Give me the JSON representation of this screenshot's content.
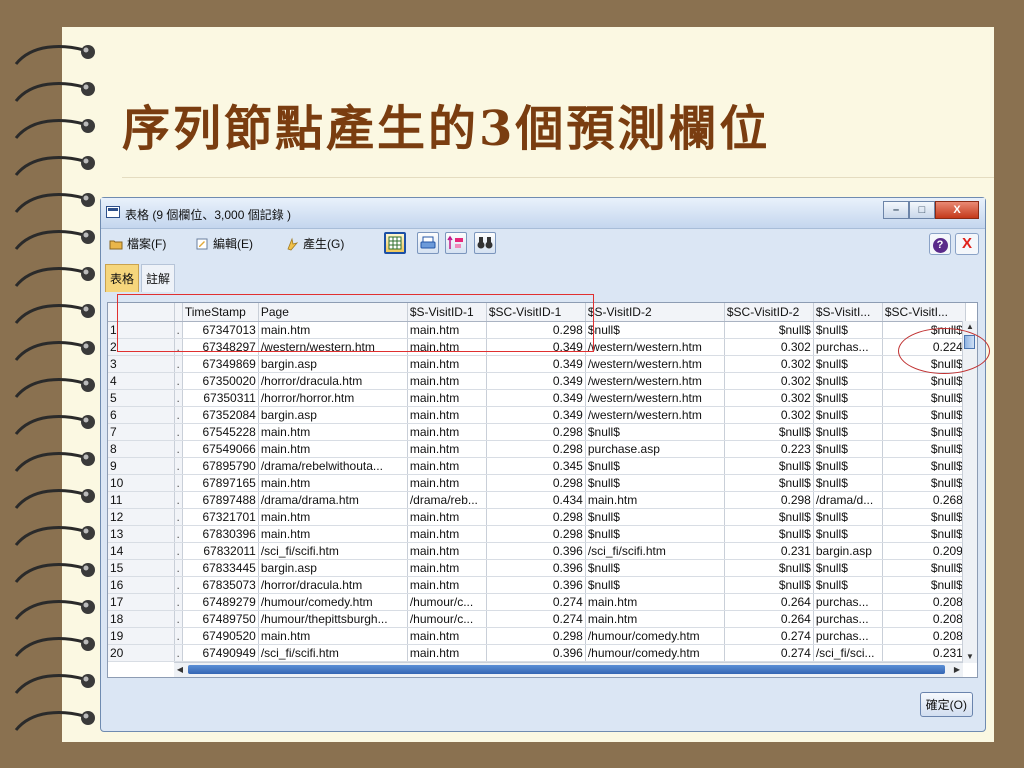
{
  "slide": {
    "title": "序列節點產生的3個預測欄位"
  },
  "window": {
    "title": "表格 (9 個欄位、3,000 個記錄 )",
    "caption_buttons": [
      "–",
      "□",
      "X"
    ]
  },
  "menu": {
    "items": [
      {
        "label": "檔案(F)",
        "icon": "folder-icon"
      },
      {
        "label": "編輯(E)",
        "icon": "edit-icon"
      },
      {
        "label": "產生(G)",
        "icon": "generate-icon"
      }
    ],
    "help": "?",
    "close": "X"
  },
  "tabs": [
    {
      "label": "表格",
      "active": true
    },
    {
      "label": "註解",
      "active": false
    }
  ],
  "table": {
    "columns": [
      "",
      "",
      "TimeStamp",
      "Page",
      "$S-VisitID-1",
      "$SC-VisitID-1",
      "$S-VisitID-2",
      "$SC-VisitID-2",
      "$S-VisitI...",
      "$SC-VisitI..."
    ],
    "rows": [
      [
        "1",
        ".",
        "67347013",
        "main.htm",
        "main.htm",
        "0.298",
        "$null$",
        "$null$",
        "$null$",
        "$null$"
      ],
      [
        "2",
        ".",
        "67348297",
        "/western/western.htm",
        "main.htm",
        "0.349",
        "/western/western.htm",
        "0.302",
        "purchas...",
        "0.224"
      ],
      [
        "3",
        ".",
        "67349869",
        "bargin.asp",
        "main.htm",
        "0.349",
        "/western/western.htm",
        "0.302",
        "$null$",
        "$null$"
      ],
      [
        "4",
        ".",
        "67350020",
        "/horror/dracula.htm",
        "main.htm",
        "0.349",
        "/western/western.htm",
        "0.302",
        "$null$",
        "$null$"
      ],
      [
        "5",
        ".",
        "67350311",
        "/horror/horror.htm",
        "main.htm",
        "0.349",
        "/western/western.htm",
        "0.302",
        "$null$",
        "$null$"
      ],
      [
        "6",
        ".",
        "67352084",
        "bargin.asp",
        "main.htm",
        "0.349",
        "/western/western.htm",
        "0.302",
        "$null$",
        "$null$"
      ],
      [
        "7",
        ".",
        "67545228",
        "main.htm",
        "main.htm",
        "0.298",
        "$null$",
        "$null$",
        "$null$",
        "$null$"
      ],
      [
        "8",
        ".",
        "67549066",
        "main.htm",
        "main.htm",
        "0.298",
        "purchase.asp",
        "0.223",
        "$null$",
        "$null$"
      ],
      [
        "9",
        ".",
        "67895790",
        "/drama/rebelwithouta...",
        "main.htm",
        "0.345",
        "$null$",
        "$null$",
        "$null$",
        "$null$"
      ],
      [
        "10",
        ".",
        "67897165",
        "main.htm",
        "main.htm",
        "0.298",
        "$null$",
        "$null$",
        "$null$",
        "$null$"
      ],
      [
        "11",
        ".",
        "67897488",
        "/drama/drama.htm",
        "/drama/reb...",
        "0.434",
        "main.htm",
        "0.298",
        "/drama/d...",
        "0.268"
      ],
      [
        "12",
        ".",
        "67321701",
        "main.htm",
        "main.htm",
        "0.298",
        "$null$",
        "$null$",
        "$null$",
        "$null$"
      ],
      [
        "13",
        ".",
        "67830396",
        "main.htm",
        "main.htm",
        "0.298",
        "$null$",
        "$null$",
        "$null$",
        "$null$"
      ],
      [
        "14",
        ".",
        "67832011",
        "/sci_fi/scifi.htm",
        "main.htm",
        "0.396",
        "/sci_fi/scifi.htm",
        "0.231",
        "bargin.asp",
        "0.209"
      ],
      [
        "15",
        ".",
        "67833445",
        "bargin.asp",
        "main.htm",
        "0.396",
        "$null$",
        "$null$",
        "$null$",
        "$null$"
      ],
      [
        "16",
        ".",
        "67835073",
        "/horror/dracula.htm",
        "main.htm",
        "0.396",
        "$null$",
        "$null$",
        "$null$",
        "$null$"
      ],
      [
        "17",
        ".",
        "67489279",
        "/humour/comedy.htm",
        "/humour/c...",
        "0.274",
        "main.htm",
        "0.264",
        "purchas...",
        "0.208"
      ],
      [
        "18",
        ".",
        "67489750",
        "/humour/thepittsburgh...",
        "/humour/c...",
        "0.274",
        "main.htm",
        "0.264",
        "purchas...",
        "0.208"
      ],
      [
        "19",
        ".",
        "67490520",
        "main.htm",
        "main.htm",
        "0.298",
        "/humour/comedy.htm",
        "0.274",
        "purchas...",
        "0.208"
      ],
      [
        "20",
        ".",
        "67490949",
        "/sci_fi/scifi.htm",
        "main.htm",
        "0.396",
        "/humour/comedy.htm",
        "0.274",
        "/sci_fi/sci...",
        "0.231"
      ]
    ]
  },
  "footer": {
    "ok_label": "確定(O)"
  },
  "colors": {
    "background": "#8a7150",
    "slide": "#fbf8e2",
    "title": "#7a3d10",
    "annotation": "#e03030"
  }
}
